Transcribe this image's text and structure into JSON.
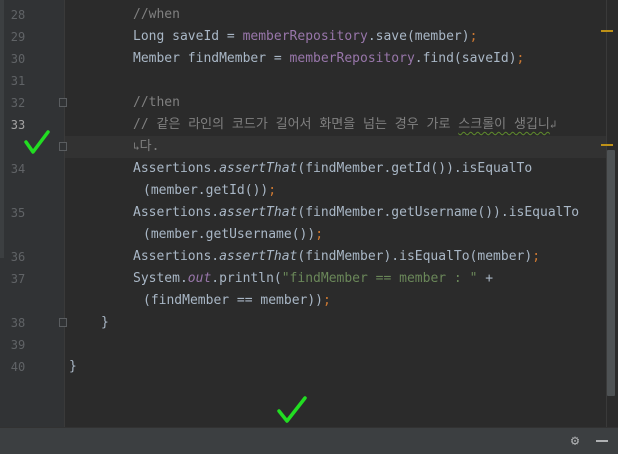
{
  "colors": {
    "background": "#2b2b2b",
    "gutter": "#313335",
    "comment": "#808080",
    "field": "#9876aa",
    "keyword": "#cc7832",
    "string": "#6a8759",
    "default_text": "#a9b7c6",
    "check_mark": "#22dd22",
    "marker": "#be9117"
  },
  "line_numbers": [
    "28",
    "29",
    "30",
    "31",
    "32",
    "33",
    "34",
    "35",
    "36",
    "37",
    "38",
    "39",
    "40"
  ],
  "current_line": "33",
  "code": {
    "l28": "//when",
    "l29_a": "Long saveId = ",
    "l29_b": "memberRepository",
    "l29_c": ".save(member)",
    "l29_d": ";",
    "l30_a": "Member findMember = ",
    "l30_b": "memberRepository",
    "l30_c": ".find(saveId)",
    "l30_d": ";",
    "l32": "//then",
    "l33_a": "// 같은 라인의 코드가 길어서 화면을 넘는 경우 가로 ",
    "l33_b": "스크롤이 생깁니",
    "l33_wrap": "↲",
    "l33_cont_mark": "↳",
    "l33_cont": "다.",
    "l34_a": "Assertions.",
    "l34_b": "assertThat",
    "l34_c": "(findMember.getId()).isEqualTo",
    "l34_cont": "(member.getId())",
    "l34_end": ";",
    "l35_a": "Assertions.",
    "l35_b": "assertThat",
    "l35_c": "(findMember.getUsername()).isEqualTo",
    "l35_cont": "(member.getUsername())",
    "l35_end": ";",
    "l36_a": "Assertions.",
    "l36_b": "assertThat",
    "l36_c": "(findMember).isEqualTo(member)",
    "l36_d": ";",
    "l37_a": "System.",
    "l37_b": "out",
    "l37_c": ".println(",
    "l37_d": "\"findMember == member : \"",
    "l37_e": " +",
    "l37_cont": "(findMember == member))",
    "l37_end": ";",
    "l38": "}",
    "l40": "}"
  },
  "icons": {
    "settings": "gear-icon",
    "minimize": "minimize-icon",
    "check_marks": "check-mark-icon"
  }
}
